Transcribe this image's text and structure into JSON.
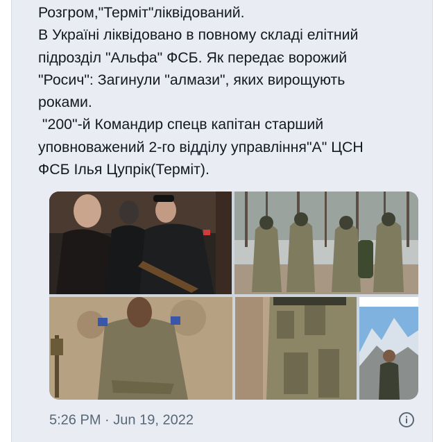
{
  "tweet": {
    "lines": [
      "Розгром,\"Терміт\"ліквідований.",
      "В Україні ліквідовано в повному складі елітний",
      "підрозділ \"Альфа\" ФСБ. Як передає ворожий",
      "\"Росич\": Загинули \"алмази\", яких вирощують",
      "роками.",
      " \"200\"-й Командир спецв капітан старший",
      "уповноважений 2-го відділу управління\"А\" ЦСН",
      "ФСБ Ілья Цупрік(Терміт)."
    ],
    "time": "5:26 PM",
    "separator": "·",
    "date": "Jun 19, 2022"
  },
  "media": {
    "photos": [
      "photo-ceremony",
      "photo-soldiers-forest",
      "photo-soldier-sitting",
      "photo-soldiers-closeup",
      "photo-mountain-portrait"
    ]
  },
  "icons": {
    "info": "info-icon"
  },
  "colors": {
    "background": "#e9edf3",
    "text": "#141823",
    "meta": "#586776"
  }
}
